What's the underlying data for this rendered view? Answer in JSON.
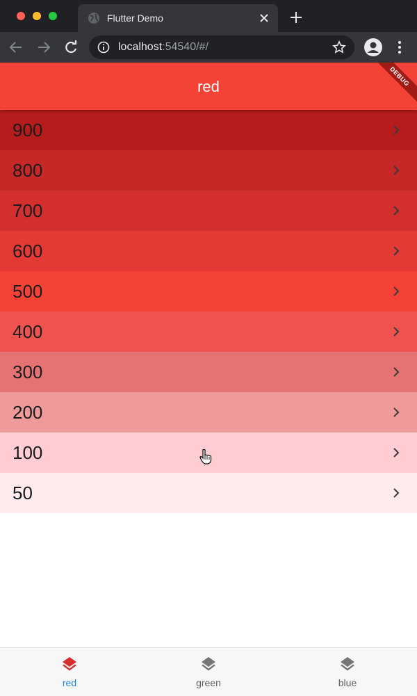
{
  "browser": {
    "tab_title": "Flutter Demo",
    "url_host": "localhost",
    "url_rest": ":54540/#/"
  },
  "app": {
    "title": "red",
    "debug_banner": "DEBUG",
    "accent": "#f44336"
  },
  "list": {
    "items": [
      {
        "label": "900",
        "color": "#b71c1c"
      },
      {
        "label": "800",
        "color": "#c62828"
      },
      {
        "label": "700",
        "color": "#d32f2f"
      },
      {
        "label": "600",
        "color": "#e53935"
      },
      {
        "label": "500",
        "color": "#f44336"
      },
      {
        "label": "400",
        "color": "#ef5350"
      },
      {
        "label": "300",
        "color": "#e57373"
      },
      {
        "label": "200",
        "color": "#ef9a9a"
      },
      {
        "label": "100",
        "color": "#ffcdd2"
      },
      {
        "label": "50",
        "color": "#ffebee"
      }
    ]
  },
  "bottom_nav": {
    "items": [
      {
        "label": "red",
        "selected": true,
        "color": "#d32f2f",
        "label_color": "#1e88e5"
      },
      {
        "label": "green",
        "selected": false,
        "color": "#757575",
        "label_color": "#616161"
      },
      {
        "label": "blue",
        "selected": false,
        "color": "#757575",
        "label_color": "#616161"
      }
    ]
  }
}
